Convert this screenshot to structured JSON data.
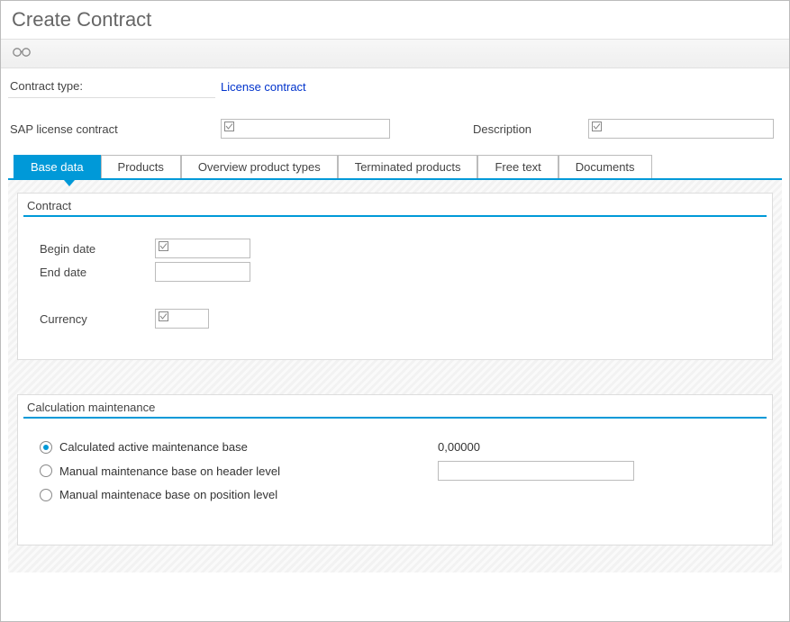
{
  "title": "Create Contract",
  "header": {
    "contract_type_label": "Contract type:",
    "contract_type_value": "License contract",
    "sap_license_label": "SAP license contract",
    "description_label": "Description"
  },
  "tabs": [
    {
      "label": "Base data"
    },
    {
      "label": "Products"
    },
    {
      "label": "Overview product types"
    },
    {
      "label": "Terminated products"
    },
    {
      "label": "Free text"
    },
    {
      "label": "Documents"
    }
  ],
  "contract_group": {
    "title": "Contract",
    "begin_date_label": "Begin date",
    "end_date_label": "End date",
    "currency_label": "Currency"
  },
  "calc_group": {
    "title": "Calculation maintenance",
    "opt1_label": "Calculated active maintenance base",
    "opt1_value": "0,00000",
    "opt2_label": "Manual maintenance base on header level",
    "opt3_label": "Manual maintenace base on position level"
  }
}
